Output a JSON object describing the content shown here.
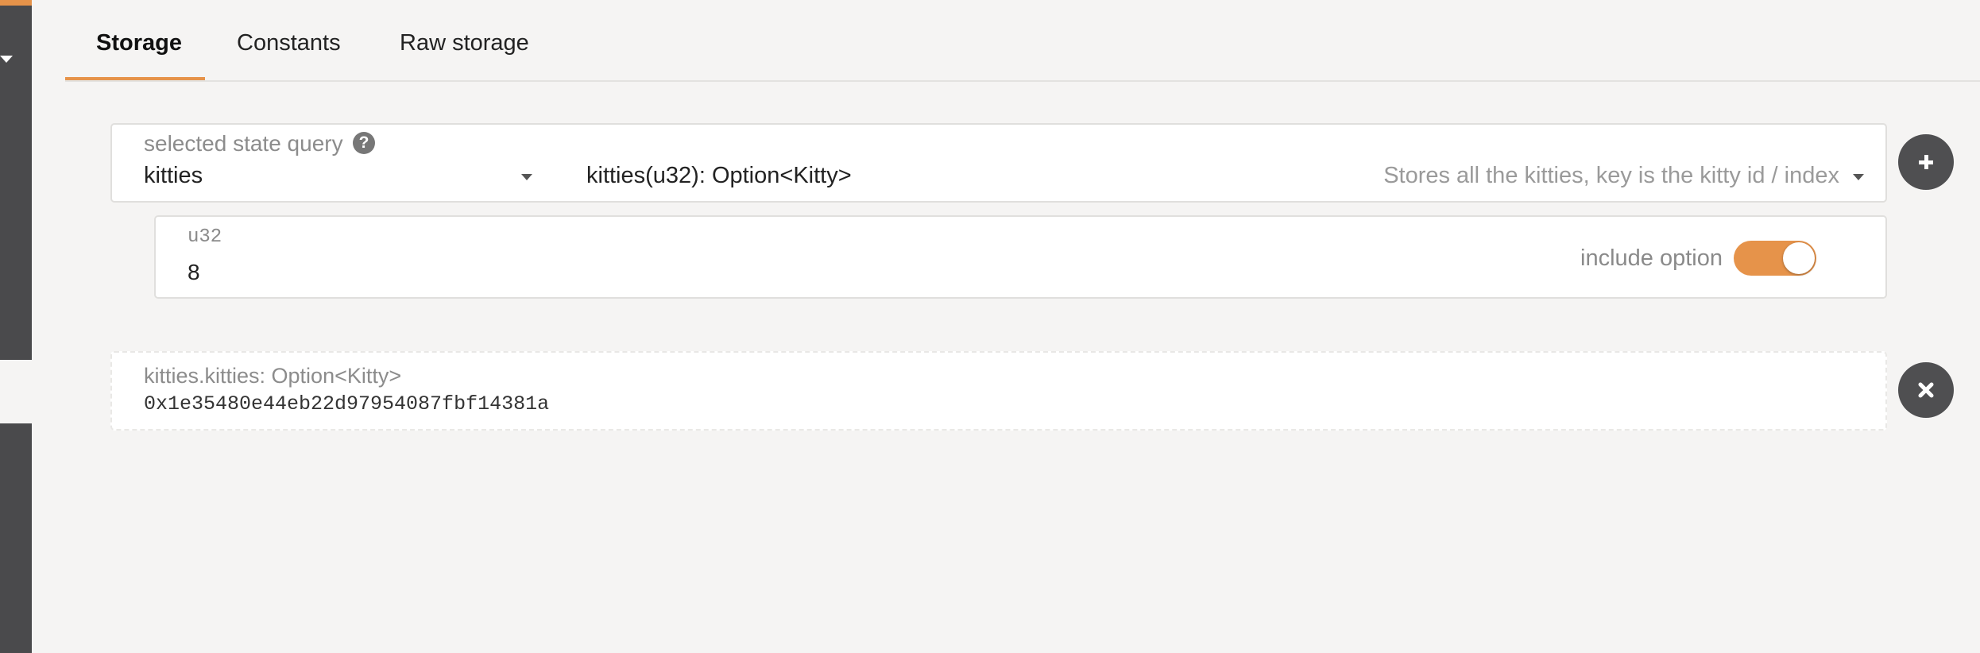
{
  "tabs": [
    {
      "label": "Storage",
      "active": true
    },
    {
      "label": "Constants",
      "active": false
    },
    {
      "label": "Raw storage",
      "active": false
    }
  ],
  "query": {
    "label": "selected state query",
    "section": "kitties",
    "method": "kitties(u32): Option<Kitty>",
    "doc": "Stores all the kitties, key is the kitty id / index"
  },
  "param": {
    "type_label": "u32",
    "value": "8",
    "toggle_label": "include option",
    "toggle_on": true
  },
  "result": {
    "label": "kitties.kitties: Option<Kitty>",
    "value": "0x1e35480e44eb22d97954087fbf14381a"
  },
  "icons": {
    "help": "question-circle-icon",
    "add": "plus-icon",
    "remove": "close-icon",
    "dropdown": "caret-down-icon"
  },
  "colors": {
    "accent": "#e6934a",
    "sidebar": "#4a4a4c",
    "background": "#f5f4f3",
    "button": "#4f4f51"
  }
}
